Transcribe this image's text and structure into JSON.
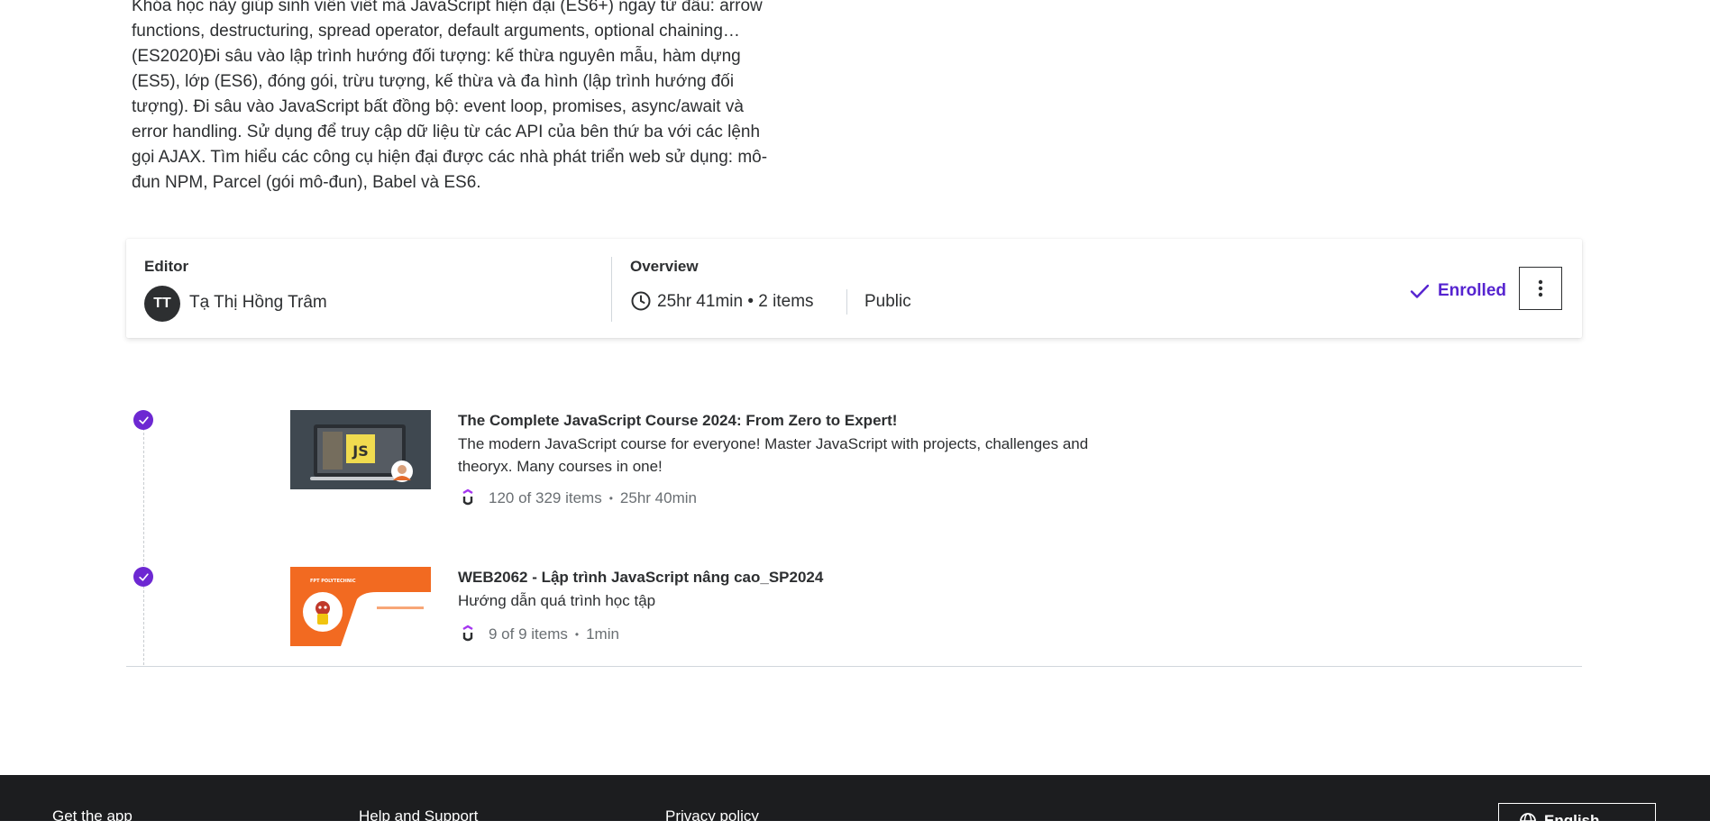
{
  "description": "Khóa học này giúp sinh viên viết mã JavaScript hiện đại (ES6+) ngay từ đầu: arrow\nfunctions, destructuring, spread operator, default arguments, optional chaining…\n(ES2020)Đi sâu vào lập trình hướng đối tượng: kế thừa nguyên mẫu, hàm dựng\n(ES5), lớp (ES6), đóng gói, trừu tượng, kế thừa và đa hình (lập trình hướng đối\ntượng). Đi sâu vào JavaScript bất đồng bộ: event loop, promises, async/await và\nerror handling. Sử dụng để truy cập dữ liệu từ các API của bên thứ ba với các lệnh\ngọi AJAX. Tìm hiểu các công cụ hiện đại được các nhà phát triển web sử dụng: mô-\nđun NPM, Parcel (gói mô-đun), Babel và ES6.",
  "info": {
    "editor_title": "Editor",
    "avatar_initials": "TT",
    "editor_name": "Tạ Thị Hồng Trâm",
    "overview_title": "Overview",
    "duration": "25hr 41min",
    "items_count": "2 items",
    "visibility": "Public",
    "enrolled_label": "Enrolled"
  },
  "courses": [
    {
      "title": "The Complete JavaScript Course 2024: From Zero to Expert!",
      "description": "The modern JavaScript course for everyone! Master JavaScript with projects, challenges and theoryx. Many courses in one!",
      "progress": "120 of 329 items",
      "duration": "25hr 40min",
      "thumb_text": "JS"
    },
    {
      "title": "WEB2062 - Lập trình JavaScript nâng cao_SP2024",
      "description": "Hướng dẫn quá trình học tập",
      "progress": "9 of 9 items",
      "duration": "1min",
      "thumb_text": "FPT POLYTECHNIC"
    }
  ],
  "footer": {
    "links": [
      "Get the app",
      "Help and Support",
      "Privacy policy"
    ],
    "language_label": "English"
  },
  "colors": {
    "accent": "#5624d0",
    "check": "#6d28d2",
    "footer_bg": "#1c1d1f",
    "thumb2_bg": "#f26a21"
  }
}
